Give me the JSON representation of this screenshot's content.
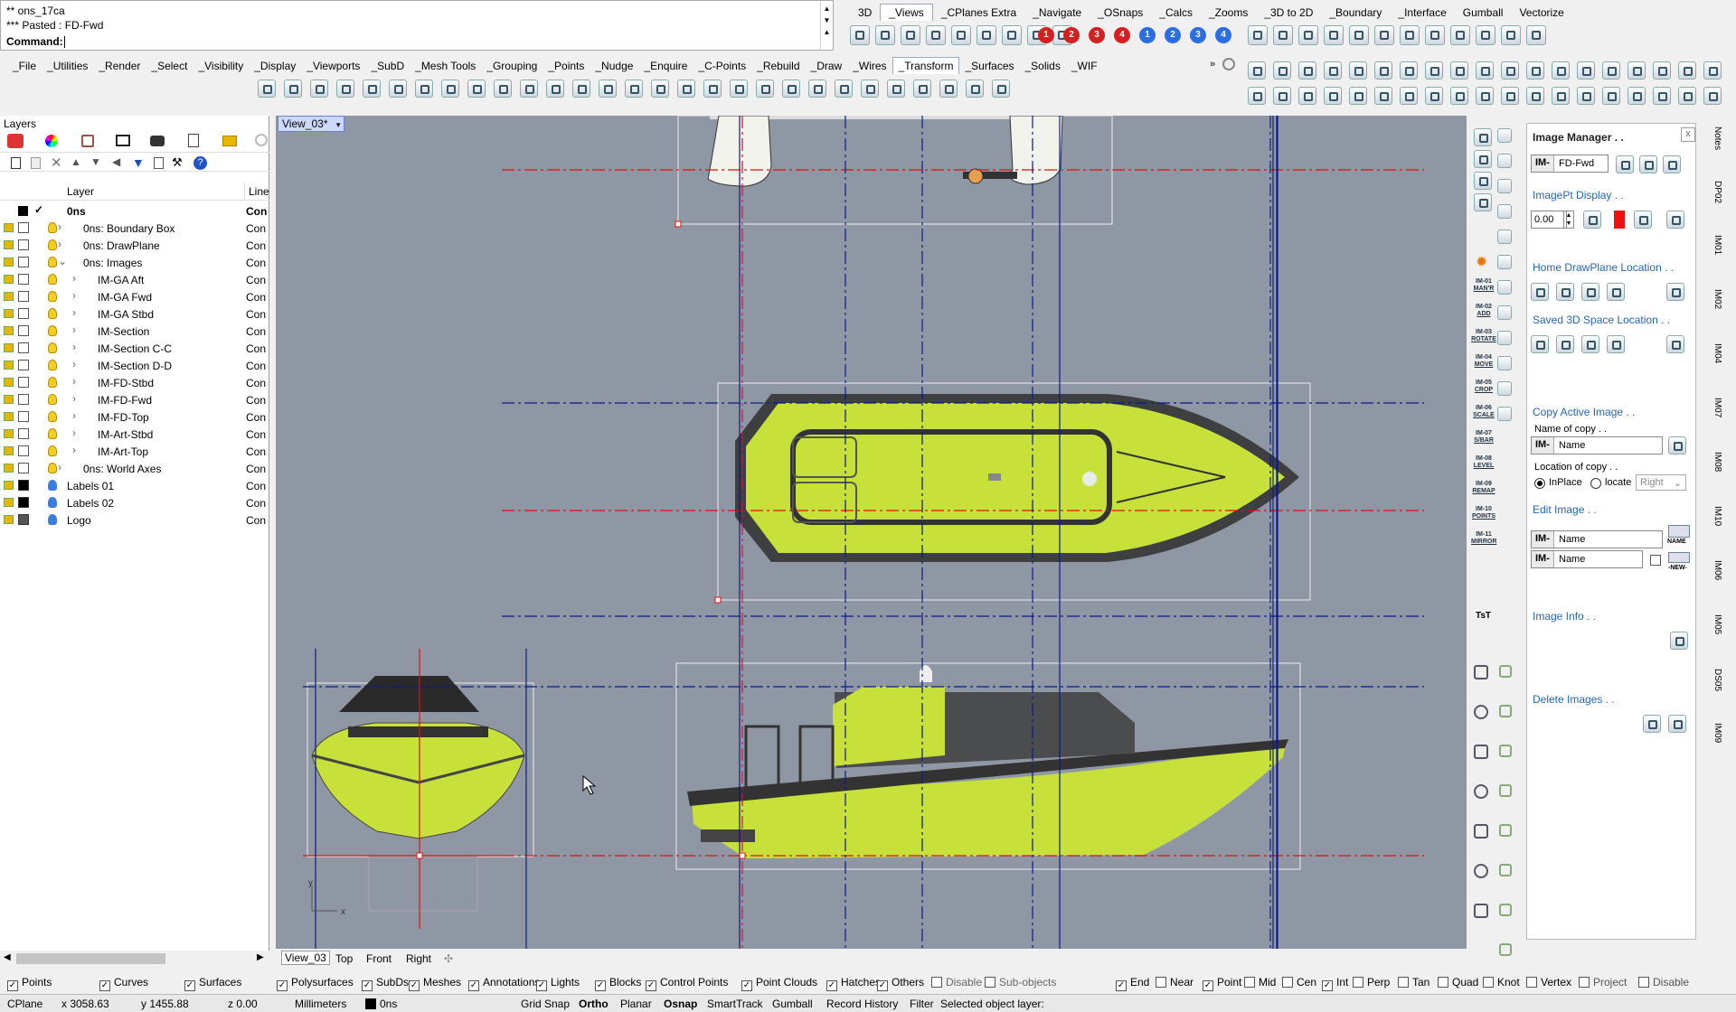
{
  "command": {
    "history": [
      "** ons_17ca",
      "*** Pasted : FD-Fwd"
    ],
    "prompt": "Command:"
  },
  "toolbar_tabs_top": [
    "3D",
    "_Views",
    "_CPlanes Extra",
    "_Navigate",
    "_OSnaps",
    "_Calcs",
    "_Zooms",
    "_3D to 2D",
    "_Boundary",
    "_Interface",
    "Gumball",
    "Vectorize"
  ],
  "toolbar_tabs_main": [
    "_File",
    "_Utilities",
    "_Render",
    "_Select",
    "_Visibility",
    "_Display",
    "_Viewports",
    "_SubD",
    "_Mesh Tools",
    "_Grouping",
    "_Points",
    "_Nudge",
    "_Enquire",
    "_C-Points",
    "_Rebuild",
    "_Draw",
    "_Wires",
    "_Transform",
    "_Surfaces",
    "_Solids",
    "_WIF"
  ],
  "numbered_buttons": [
    "1",
    "2",
    "3",
    "4",
    "1",
    "2",
    "3",
    "4"
  ],
  "layers": {
    "title": "Layers",
    "col_layer": "Layer",
    "col_line": "Line",
    "rows": [
      {
        "name": "0ns",
        "line": "Con",
        "indent": 0,
        "current": true,
        "color": "#000000"
      },
      {
        "name": "0ns: Boundary Box",
        "line": "Con",
        "indent": 1,
        "color": "#ffffff"
      },
      {
        "name": "0ns: DrawPlane",
        "line": "Con",
        "indent": 1,
        "color": "#ffffff"
      },
      {
        "name": "0ns: Images",
        "line": "Con",
        "indent": 1,
        "expanded": true,
        "color": "#ffffff"
      },
      {
        "name": "IM-GA Aft",
        "line": "Con",
        "indent": 2,
        "color": "#ffffff"
      },
      {
        "name": "IM-GA Fwd",
        "line": "Con",
        "indent": 2,
        "color": "#ffffff"
      },
      {
        "name": "IM-GA Stbd",
        "line": "Con",
        "indent": 2,
        "color": "#ffffff"
      },
      {
        "name": "IM-Section",
        "line": "Con",
        "indent": 2,
        "color": "#ffffff"
      },
      {
        "name": "IM-Section C-C",
        "line": "Con",
        "indent": 2,
        "color": "#ffffff"
      },
      {
        "name": "IM-Section D-D",
        "line": "Con",
        "indent": 2,
        "color": "#ffffff"
      },
      {
        "name": "IM-FD-Stbd",
        "line": "Con",
        "indent": 2,
        "color": "#ffffff"
      },
      {
        "name": "IM-FD-Fwd",
        "line": "Con",
        "indent": 2,
        "color": "#ffffff"
      },
      {
        "name": "IM-FD-Top",
        "line": "Con",
        "indent": 2,
        "color": "#ffffff"
      },
      {
        "name": "IM-Art-Stbd",
        "line": "Con",
        "indent": 2,
        "color": "#ffffff"
      },
      {
        "name": "IM-Art-Top",
        "line": "Con",
        "indent": 2,
        "color": "#ffffff"
      },
      {
        "name": "0ns: World Axes",
        "line": "Con",
        "indent": 1,
        "color": "#ffffff"
      },
      {
        "name": "Labels 01",
        "line": "Con",
        "indent": 0,
        "color": "#000000",
        "blue": true
      },
      {
        "name": "Labels 02",
        "line": "Con",
        "indent": 0,
        "color": "#000000",
        "blue": true
      },
      {
        "name": "Logo",
        "line": "Con",
        "indent": 0,
        "color": "#555555",
        "blue": true
      }
    ]
  },
  "viewport": {
    "title": "View_03*",
    "tabs": [
      "View_03",
      "Top",
      "Front",
      "Right"
    ],
    "axis_x": "x",
    "axis_y": "y"
  },
  "image_manager": {
    "title": "Image Manager . .",
    "close": "x",
    "im_prefix": "IM-",
    "current_image": "FD-Fwd",
    "imagept_display": "ImagePt Display . .",
    "imagept_value": "0.00",
    "home_drawplane": "Home DrawPlane Location . .",
    "saved_3d_space": "Saved 3D Space Location . .",
    "copy_active_image": "Copy Active Image . .",
    "name_of_copy": "Name of copy . .",
    "name_placeholder": "Name",
    "location_of_copy": "Location of copy . .",
    "inplace": "InPlace",
    "locate": "locate",
    "locate_direction": "Right",
    "edit_image": "Edit Image . .",
    "name_btn": "NAME",
    "new_btn": "-NEW-",
    "image_info": "Image Info . .",
    "delete_images": "Delete Images . .",
    "accent_color": "#2566b8"
  },
  "im_tools": [
    {
      "num": "IM-01",
      "label": "MAN'R"
    },
    {
      "num": "IM-02",
      "label": "ADD"
    },
    {
      "num": "IM-03",
      "label": "ROTATE"
    },
    {
      "num": "IM-04",
      "label": "MOVE"
    },
    {
      "num": "IM-05",
      "label": "CROP"
    },
    {
      "num": "IM-06",
      "label": "SCALE"
    },
    {
      "num": "IM-07",
      "label": "S/BAR"
    },
    {
      "num": "IM-08",
      "label": "LEVEL"
    },
    {
      "num": "IM-09",
      "label": "REMAP"
    },
    {
      "num": "IM-10",
      "label": "POINTS"
    },
    {
      "num": "IM-11",
      "label": "MIRROR"
    }
  ],
  "side_label_tst": "TsT",
  "vertical_tabs": [
    "Notes",
    "DP02",
    "IM01",
    "IM02",
    "IM04",
    "IM07",
    "IM08",
    "IM10",
    "IM06",
    "IM05",
    "DS05",
    "IM09"
  ],
  "filters": [
    {
      "label": "Points",
      "checked": true
    },
    {
      "label": "Curves",
      "checked": true
    },
    {
      "label": "Surfaces",
      "checked": true
    },
    {
      "label": "Polysurfaces",
      "checked": true
    },
    {
      "label": "SubDs",
      "checked": true
    },
    {
      "label": "Meshes",
      "checked": true
    },
    {
      "label": "Annotations",
      "checked": true
    },
    {
      "label": "Lights",
      "checked": true
    },
    {
      "label": "Blocks",
      "checked": true
    },
    {
      "label": "Control Points",
      "checked": true
    },
    {
      "label": "Point Clouds",
      "checked": true
    },
    {
      "label": "Hatches",
      "checked": true
    },
    {
      "label": "Others",
      "checked": true
    },
    {
      "label": "Disable",
      "checked": false
    },
    {
      "label": "Sub-objects",
      "checked": false
    }
  ],
  "osnaps": [
    {
      "label": "End",
      "checked": true
    },
    {
      "label": "Near",
      "checked": false
    },
    {
      "label": "Point",
      "checked": true
    },
    {
      "label": "Mid",
      "checked": false
    },
    {
      "label": "Cen",
      "checked": false
    },
    {
      "label": "Int",
      "checked": true
    },
    {
      "label": "Perp",
      "checked": false
    },
    {
      "label": "Tan",
      "checked": false
    },
    {
      "label": "Quad",
      "checked": false
    },
    {
      "label": "Knot",
      "checked": false
    },
    {
      "label": "Vertex",
      "checked": false
    },
    {
      "label": "Project",
      "checked": false
    },
    {
      "label": "Disable",
      "checked": false
    }
  ],
  "status": {
    "cplane": "CPlane",
    "x": "x 3058.63",
    "y": "y 1455.88",
    "z": "z 0.00",
    "units": "Millimeters",
    "layer": "0ns",
    "grid_snap": "Grid Snap",
    "ortho": "Ortho",
    "planar": "Planar",
    "osnap": "Osnap",
    "smarttrack": "SmartTrack",
    "gumball": "Gumball",
    "record_history": "Record History",
    "filter": "Filter",
    "message": "Selected object layer:"
  },
  "colors": {
    "hull_yellow": "#c8e03a",
    "viewport_bg": "#9097a4",
    "guide_red": "#e01010",
    "guide_blue": "#0a1a8a"
  }
}
